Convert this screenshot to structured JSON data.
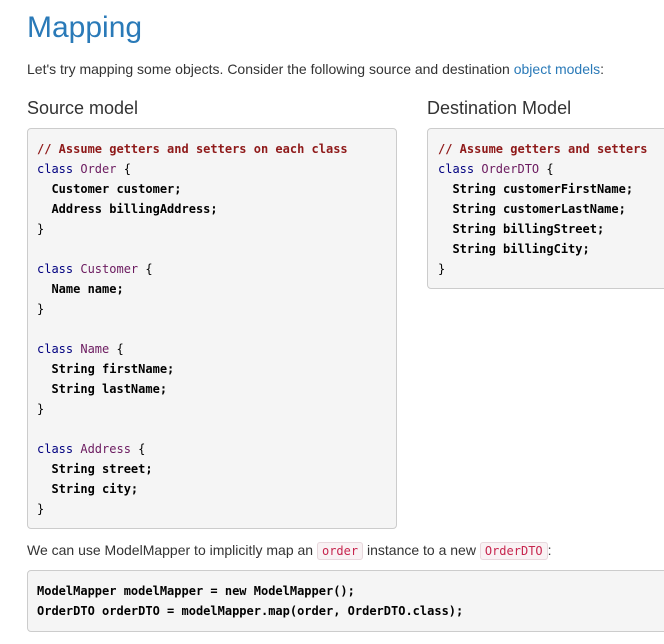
{
  "title": "Mapping",
  "intro": {
    "text": "Let's try mapping some objects. Consider the following source and destination ",
    "link": "object models",
    "tail": ":"
  },
  "source": {
    "heading": "Source model",
    "comment": "// Assume getters and setters on each class",
    "kw_class": "class",
    "order_name": "Order",
    "brace_open": " {",
    "brace_close": "}",
    "order_f1": "  Customer customer;",
    "order_f2": "  Address billingAddress;",
    "customer_name": "Customer",
    "customer_f1": "  Name name;",
    "name_name": "Name",
    "name_f1": "  String firstName;",
    "name_f2": "  String lastName;",
    "address_name": "Address",
    "address_f1": "  String street;",
    "address_f2": "  String city;"
  },
  "dest": {
    "heading": "Destination Model",
    "comment": "// Assume getters and setters",
    "kw_class": "class",
    "dto_name": "OrderDTO",
    "brace_open": " {",
    "brace_close": "}",
    "f1": "  String customerFirstName;",
    "f2": "  String customerLastName;",
    "f3": "  String billingStreet;",
    "f4": "  String billingCity;"
  },
  "para": {
    "text1": "We can use ModelMapper to implicitly map an ",
    "code1": "order",
    "text2": " instance to a new ",
    "code2": "OrderDTO",
    "text3": ":"
  },
  "snippet": {
    "line1": "ModelMapper modelMapper = new ModelMapper();",
    "line2": "OrderDTO orderDTO = modelMapper.map(order, OrderDTO.class);"
  }
}
